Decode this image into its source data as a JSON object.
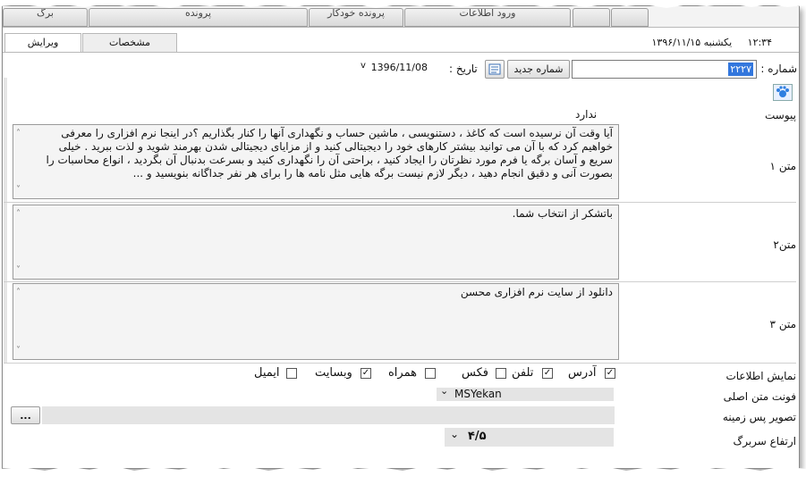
{
  "top_tabs": [
    "برگ",
    "پرونده",
    "پرونده خودکار",
    "ورود اطلاعات",
    "",
    ""
  ],
  "sub_tabs": {
    "edit": "ویرایش",
    "specs": "مشخصات"
  },
  "datetime": {
    "time": "۱۲:۳۴",
    "date": "یکشنبه ۱۳۹۶/۱۱/۱۵"
  },
  "number": {
    "label": "شماره :",
    "value": "۲۲۲۷"
  },
  "new_number_button": "شماره جدید",
  "date_field": {
    "label": "تاریخ :",
    "value": "1396/11/08"
  },
  "attachment": {
    "label": "پیوست",
    "value": "ندارد"
  },
  "text1": {
    "label": "متن ۱",
    "value": "آیا وقت آن نرسیده است که کاغذ ، دستنویسی ، ماشین حساب و نگهداری آنها را کنار بگذاریم ؟در اینجا نرم افزاری را معرفی خواهیم کرد که با آن می توانید بیشتر کارهای خود را دیجیتالی کنید و از مزایای دیجیتالی شدن بهرمند شوید و لذت ببرید . خیلی سریع و آسان برگه یا فرم مورد نظرتان را ایجاد کنید ، براحتی آن را نگهداری کنید و بسرعت بدنبال آن بگردید ، انواع محاسبات را بصورت آنی و دقیق انجام دهید ، دیگر لازم نیست برگه هایی مثل نامه ها را برای هر نفر جداگانه بنویسید و ..."
  },
  "text2": {
    "label": "متن۲",
    "value": "باتشکر از انتخاب شما."
  },
  "text3": {
    "label": "متن ۳",
    "value": "دانلود از سایت نرم افزاری محسن"
  },
  "display_info": {
    "label": "نمایش اطلاعات",
    "options": [
      {
        "name": "آدرس",
        "checked": true
      },
      {
        "name": "تلفن",
        "checked": true
      },
      {
        "name": "فکس",
        "checked": false
      },
      {
        "name": "همراه",
        "checked": false
      },
      {
        "name": "وبسایت",
        "checked": true
      },
      {
        "name": "ایمیل",
        "checked": false
      }
    ]
  },
  "font": {
    "label": "فونت متن اصلی",
    "value": "MSYekan"
  },
  "background_image": {
    "label": "تصویر پس زمینه",
    "button": "..."
  },
  "header_height": {
    "label": "ارتفاع سربرگ",
    "value": "۴/۵"
  },
  "check_mark": "✓",
  "chevron_down": "⌄",
  "scroll_up": "˄",
  "scroll_down": "˅",
  "dropdown": "v"
}
